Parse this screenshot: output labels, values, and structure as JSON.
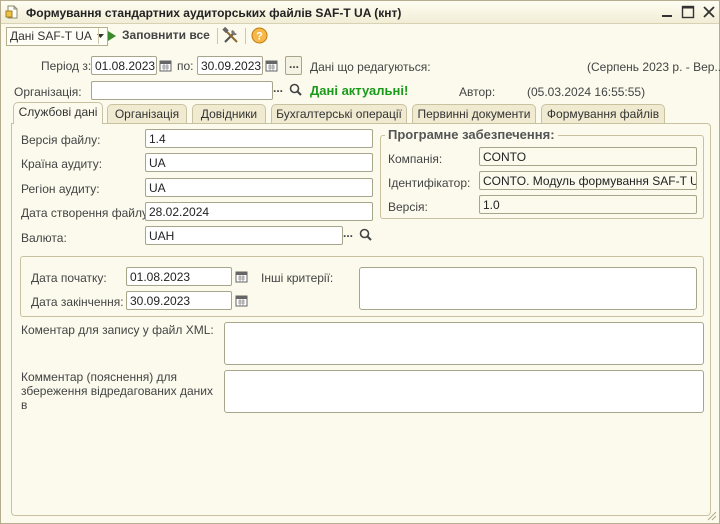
{
  "window": {
    "title": "Формування стандартних аудиторських файлів SAF-T UA (кнт)"
  },
  "toolbar": {
    "data_dropdown": "Дані SAF-T UA",
    "fill_all": "Заповнити все"
  },
  "header": {
    "period_label": "Період з:",
    "period_from": "01.08.2023",
    "to_label": "по:",
    "period_to": "30.09.2023",
    "editing_label": "Дані що редагуються:",
    "editing_value": "(Серпень 2023 р. - Вер...",
    "organization_label": "Організація:",
    "organization_value": "",
    "status": "Дані актуальні!",
    "author_label": "Автор:",
    "author_value": "(05.03.2024 16:55:55)"
  },
  "tabs": [
    {
      "label": "Службові дані"
    },
    {
      "label": "Організація"
    },
    {
      "label": "Довідники"
    },
    {
      "label": "Бухгалтерські операції"
    },
    {
      "label": "Первинні документи"
    },
    {
      "label": "Формування файлів"
    }
  ],
  "service": {
    "file_version_label": "Версія файлу:",
    "file_version": "1.4",
    "audit_country_label": "Країна аудиту:",
    "audit_country": "UA",
    "audit_region_label": "Регіон аудиту:",
    "audit_region": "UA",
    "file_created_label": "Дата створення файлу:",
    "file_created": "28.02.2024",
    "currency_label": "Валюта:",
    "currency": "UAH"
  },
  "software": {
    "title": "Програмне забезпечення:",
    "company_label": "Компанія:",
    "company": "CONTO",
    "id_label": "Ідентифікатор:",
    "id": "CONTO. Модуль формування SAF-T UA",
    "version_label": "Версія:",
    "version": "1.0"
  },
  "criteria": {
    "start_label": "Дата початку:",
    "start": "01.08.2023",
    "end_label": "Дата закінчення:",
    "end": "30.09.2023",
    "other_label": "Інші критерії:"
  },
  "comments": {
    "xml_label": "Коментар для запису у файл XML:",
    "edited_label": "Комментар (пояснення) для збереження відредагованих даних в"
  }
}
